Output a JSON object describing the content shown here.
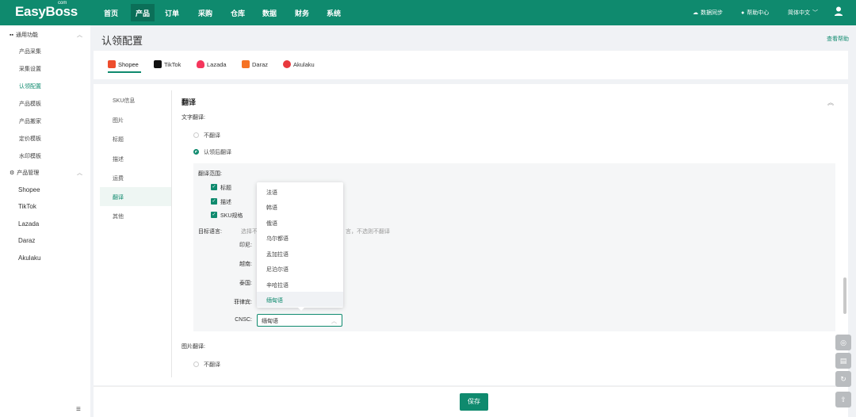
{
  "topbar": {
    "logo": "EasyBoss",
    "logo_com": "com",
    "nav": [
      "首页",
      "产品",
      "订单",
      "采购",
      "仓库",
      "数据",
      "财务",
      "系统"
    ],
    "active_nav": "产品",
    "data_sync": "数据同步",
    "help_center": "帮助中心",
    "language": "简体中文"
  },
  "sidebar": {
    "group1": "通用功能",
    "group1_items": [
      "产品采集",
      "采集设置",
      "认领配置",
      "产品模板",
      "产品搬家",
      "定价模板",
      "水印模板"
    ],
    "active_item": "认领配置",
    "group2": "产品管理",
    "group2_items": [
      "Shopee",
      "TikTok",
      "Lazada",
      "Daraz",
      "Akulaku"
    ]
  },
  "page": {
    "title": "认领配置",
    "help_link": "查看帮助"
  },
  "platform_tabs": [
    "Shopee",
    "TikTok",
    "Lazada",
    "Daraz",
    "Akulaku"
  ],
  "active_platform": "Shopee",
  "left_nav": [
    "SKU信息",
    "图片",
    "标题",
    "描述",
    "运费",
    "翻译",
    "其他"
  ],
  "active_left_nav": "翻译",
  "translation": {
    "section_title": "翻译",
    "text_translation_label": "文字翻译:",
    "options": [
      "不翻译",
      "认领后翻译"
    ],
    "selected_option": "认领后翻译",
    "scope_label": "翻译范围:",
    "scope_items": [
      "标题",
      "描述",
      "SKU规格"
    ],
    "target_lang_label": "目标语言:",
    "target_hint_start": "选择不",
    "target_hint_end": "言，不选则不翻译",
    "sites": [
      "印尼:",
      "越南:",
      "泰国:",
      "菲律宾:"
    ],
    "cnsc_label": "CNSC:",
    "cnsc_value": "缅甸语",
    "dropdown_options": [
      "法语",
      "韩语",
      "俄语",
      "乌尔都语",
      "孟加拉语",
      "尼泊尔语",
      "辛哈拉语",
      "缅甸语"
    ],
    "dropdown_selected": "缅甸语",
    "image_translation_label": "图片翻译:",
    "image_options": [
      "不翻译"
    ]
  },
  "save_label": "保存",
  "colors": {
    "brand": "#0f8a6e",
    "shopee": "#ee4d2d",
    "lazada": "#f5365c",
    "daraz": "#f57224",
    "akulaku": "#e8383d"
  }
}
